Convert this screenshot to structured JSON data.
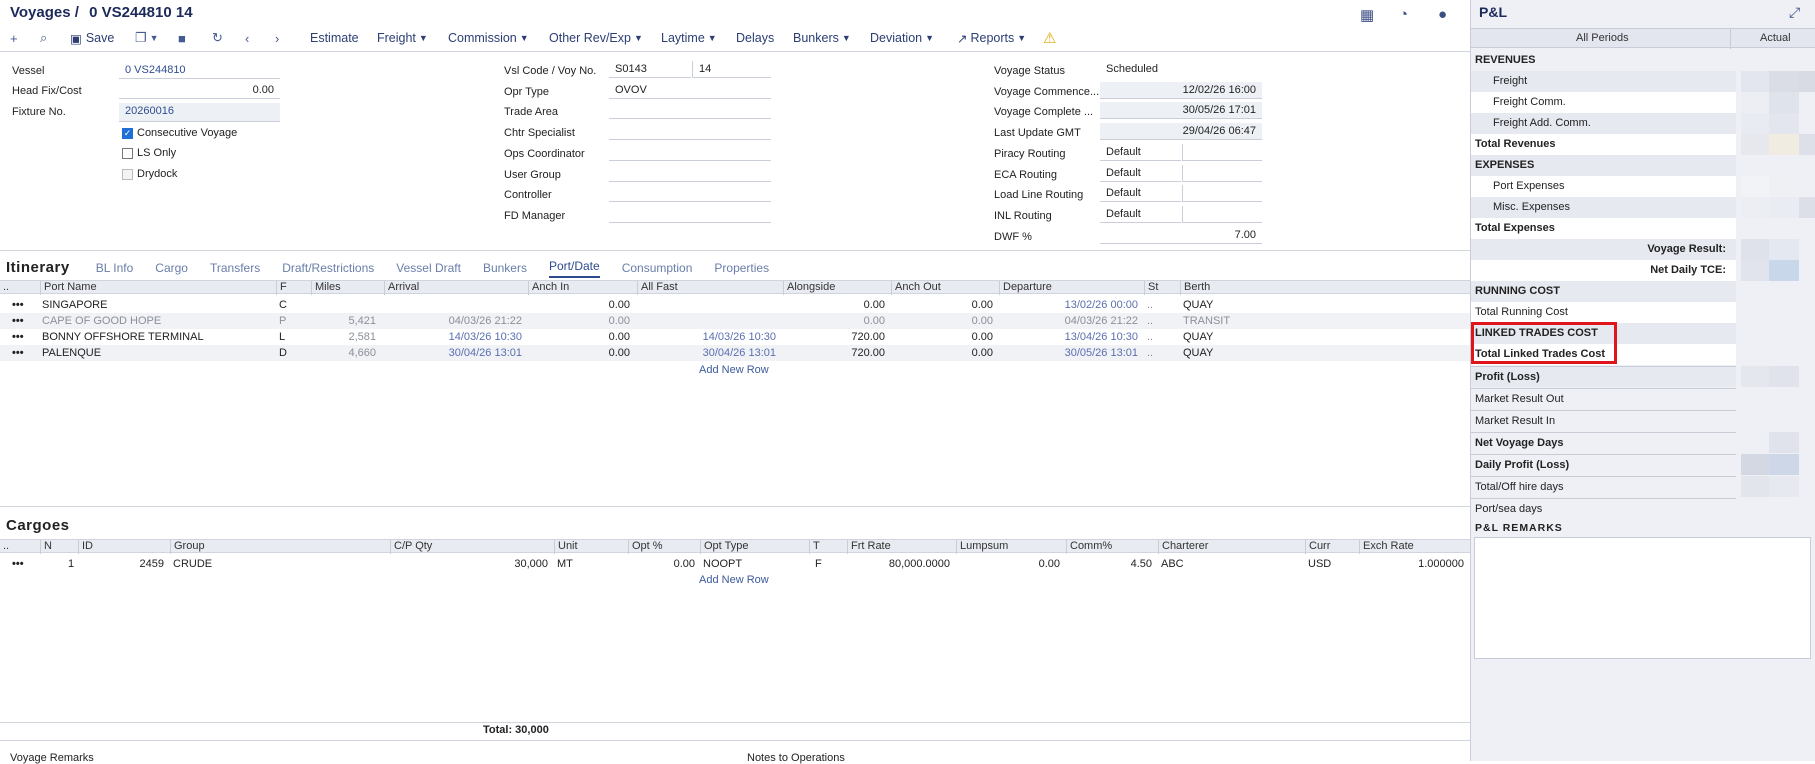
{
  "header": {
    "module": "Voyages",
    "separator": "/",
    "voyage_id": "0 VS244810 14"
  },
  "toolbar": {
    "save": "Save",
    "menus": [
      "Estimate",
      "Freight",
      "Commission",
      "Other Rev/Exp",
      "Laytime",
      "Delays",
      "Bunkers",
      "Deviation",
      "Reports"
    ]
  },
  "form": {
    "vessel_label": "Vessel",
    "vessel": "0 VS244810",
    "head_fix_label": "Head Fix/Cost",
    "head_fix": "0.00",
    "fixture_label": "Fixture No.",
    "fixture": "20260016",
    "consecutive": "Consecutive Voyage",
    "ls_only": "LS Only",
    "drydock": "Drydock",
    "vsl_code_label": "Vsl Code / Voy No.",
    "vsl_code": "S0143",
    "voy_no": "14",
    "opr_type_label": "Opr Type",
    "opr_type": "OVOV",
    "trade_area_label": "Trade Area",
    "chtr_specialist_label": "Chtr Specialist",
    "ops_coord_label": "Ops Coordinator",
    "user_group_label": "User Group",
    "controller_label": "Controller",
    "fd_manager_label": "FD Manager",
    "status_label": "Voyage Status",
    "status": "Scheduled",
    "commence_label": "Voyage Commence...",
    "commence": "12/02/26 16:00",
    "complete_label": "Voyage Complete ...",
    "complete": "30/05/26 17:01",
    "last_update_label": "Last Update GMT",
    "last_update": "29/04/26 06:47",
    "piracy_label": "Piracy Routing",
    "piracy": "Default",
    "eca_label": "ECA Routing",
    "eca": "Default",
    "load_line_label": "Load Line Routing",
    "load_line": "Default",
    "inl_label": "INL Routing",
    "inl": "Default",
    "dwf_label": "DWF %",
    "dwf": "7.00"
  },
  "itinerary": {
    "title": "Itinerary",
    "tabs": [
      "BL Info",
      "Cargo",
      "Transfers",
      "Draft/Restrictions",
      "Vessel Draft",
      "Bunkers",
      "Port/Date",
      "Consumption",
      "Properties"
    ],
    "columns": [
      "Port Name",
      "F",
      "Miles",
      "Arrival",
      "Anch In",
      "All Fast",
      "Alongside",
      "Anch Out",
      "Departure",
      "St",
      "Berth"
    ],
    "rows": [
      {
        "port": "SINGAPORE",
        "f": "C",
        "miles": "",
        "arrival": "",
        "anch_in": "0.00",
        "all_fast": "",
        "alongside": "0.00",
        "anch_out": "0.00",
        "departure": "13/02/26 00:00",
        "st": "..",
        "berth": "QUAY"
      },
      {
        "port": "CAPE OF GOOD HOPE",
        "f": "P",
        "miles": "5,421",
        "arrival": "04/03/26 21:22",
        "anch_in": "0.00",
        "all_fast": "",
        "alongside": "0.00",
        "anch_out": "0.00",
        "departure": "04/03/26 21:22",
        "st": "..",
        "berth": "TRANSIT"
      },
      {
        "port": "BONNY OFFSHORE TERMINAL",
        "f": "L",
        "miles": "2,581",
        "arrival": "14/03/26 10:30",
        "anch_in": "0.00",
        "all_fast": "14/03/26 10:30",
        "alongside": "720.00",
        "anch_out": "0.00",
        "departure": "13/04/26 10:30",
        "st": "..",
        "berth": "QUAY"
      },
      {
        "port": "PALENQUE",
        "f": "D",
        "miles": "4,660",
        "arrival": "30/04/26 13:01",
        "anch_in": "0.00",
        "all_fast": "30/04/26 13:01",
        "alongside": "720.00",
        "anch_out": "0.00",
        "departure": "30/05/26 13:01",
        "st": "..",
        "berth": "QUAY"
      }
    ],
    "add_row": "Add New Row",
    "row_menu": "•••"
  },
  "cargoes": {
    "title": "Cargoes",
    "columns": [
      "N",
      "ID",
      "Group",
      "C/P Qty",
      "Unit",
      "Opt %",
      "Opt Type",
      "T",
      "Frt Rate",
      "Lumpsum",
      "Comm%",
      "Charterer",
      "Curr",
      "Exch Rate"
    ],
    "rows": [
      {
        "n": "1",
        "id": "2459",
        "group": "CRUDE",
        "qty": "30,000",
        "unit": "MT",
        "opt": "0.00",
        "opt_type": "NOOPT",
        "t": "F",
        "frt_rate": "80,000.0000",
        "lumpsum": "0.00",
        "comm": "4.50",
        "charterer": "ABC",
        "curr": "USD",
        "exch": "1.000000"
      }
    ],
    "add_row": "Add New Row",
    "total": "Total: 30,000"
  },
  "footer": {
    "voyage_remarks": "Voyage Remarks",
    "notes_ops": "Notes to Operations"
  },
  "pnl": {
    "title": "P&L",
    "tab_periods": "All Periods",
    "tab_actual": "Actual",
    "rows": {
      "revenues": "REVENUES",
      "freight": "Freight",
      "freight_comm": "Freight Comm.",
      "freight_add_comm": "Freight Add. Comm.",
      "total_revenues": "Total Revenues",
      "expenses": "EXPENSES",
      "port_expenses": "Port Expenses",
      "misc_expenses": "Misc. Expenses",
      "total_expenses": "Total Expenses",
      "voyage_result": "Voyage Result:",
      "net_daily_tce": "Net Daily TCE:",
      "running_cost": "RUNNING COST",
      "total_running_cost": "Total Running Cost",
      "linked_trades_cost": "LINKED TRADES COST",
      "total_linked_trades_cost": "Total Linked Trades Cost",
      "profit_loss": "Profit (Loss)",
      "market_out": "Market Result Out",
      "market_in": "Market Result In",
      "net_voyage_days": "Net Voyage Days",
      "daily_profit": "Daily Profit (Loss)",
      "total_off_hire": "Total/Off hire days",
      "port_sea_days": "Port/sea days",
      "remarks": "P&L REMARKS"
    }
  },
  "colors": {
    "accent": "#2c4a8c",
    "highlight": "#e0151b"
  }
}
